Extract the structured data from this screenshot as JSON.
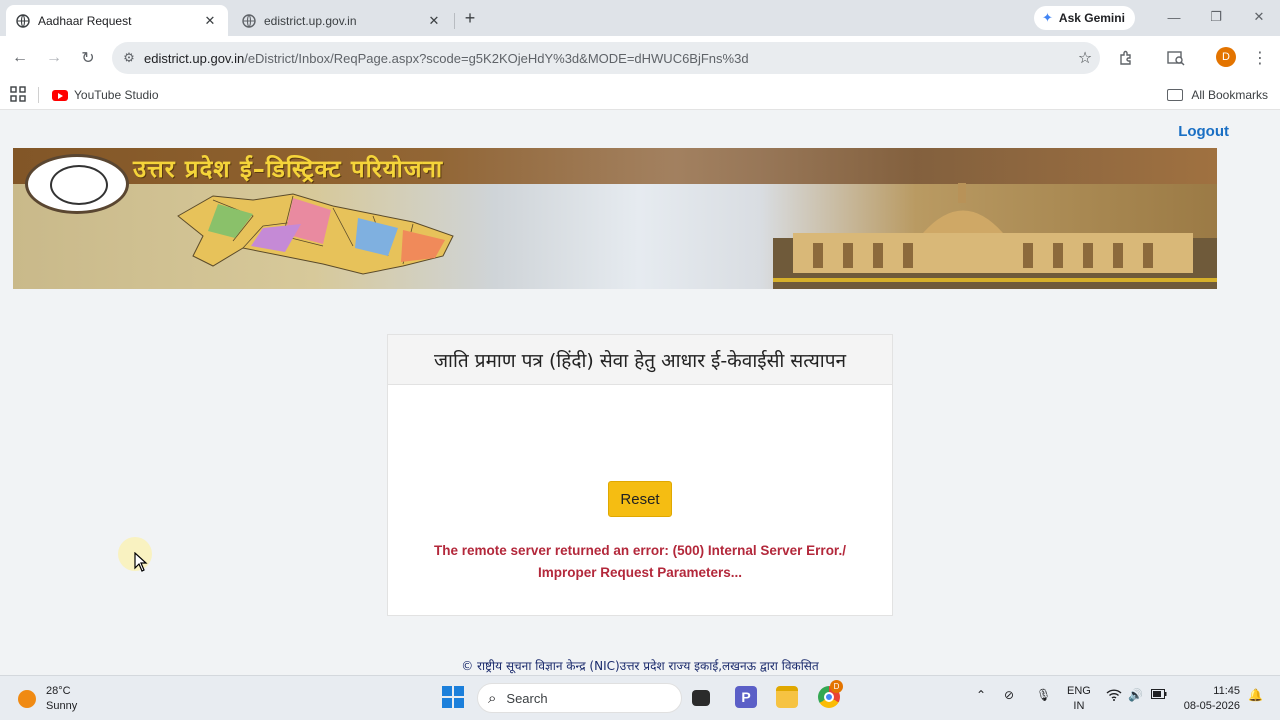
{
  "browser": {
    "tabs": [
      {
        "title": "Aadhaar Request",
        "active": true
      },
      {
        "title": "edistrict.up.gov.in",
        "active": false
      }
    ],
    "gemini_label": "Ask Gemini",
    "url_host": "edistrict.up.gov.in",
    "url_path": "/eDistrict/Inbox/ReqPage.aspx?scode=g5K2KOjeHdY%3d&MODE=dHWUC6BjFns%3d",
    "profile_initial": "D",
    "bookmarks": [
      {
        "label": "YouTube Studio"
      }
    ],
    "all_bookmarks": "All Bookmarks"
  },
  "page": {
    "logout": "Logout",
    "banner_title": "उत्तर प्रदेश ई–डिस्ट्रिक्ट परियोजना",
    "card_title": "जाति प्रमाण पत्र (हिंदी) सेवा हेतु आधार ई-केवाईसी सत्यापन",
    "reset_label": "Reset",
    "error_line1": "The remote server returned an error: (500) Internal Server Error./",
    "error_line2": "Improper Request Parameters...",
    "footer": "© राष्ट्रीय सूचना विज्ञान केन्द्र (NIC)उत्तर प्रदेश राज्य इकाई,लखनऊ द्वारा विकसित"
  },
  "taskbar": {
    "temperature": "28°C",
    "condition": "Sunny",
    "search_placeholder": "Search",
    "lang_top": "ENG",
    "lang_bottom": "IN",
    "time": "11:45",
    "date": "08-05-2026",
    "chrome_badge": "D"
  },
  "colors": {
    "link": "#1a6fc4",
    "reset_button": "#f5bd12",
    "error_text": "#b3283b",
    "footer_text": "#1a2a6c"
  }
}
